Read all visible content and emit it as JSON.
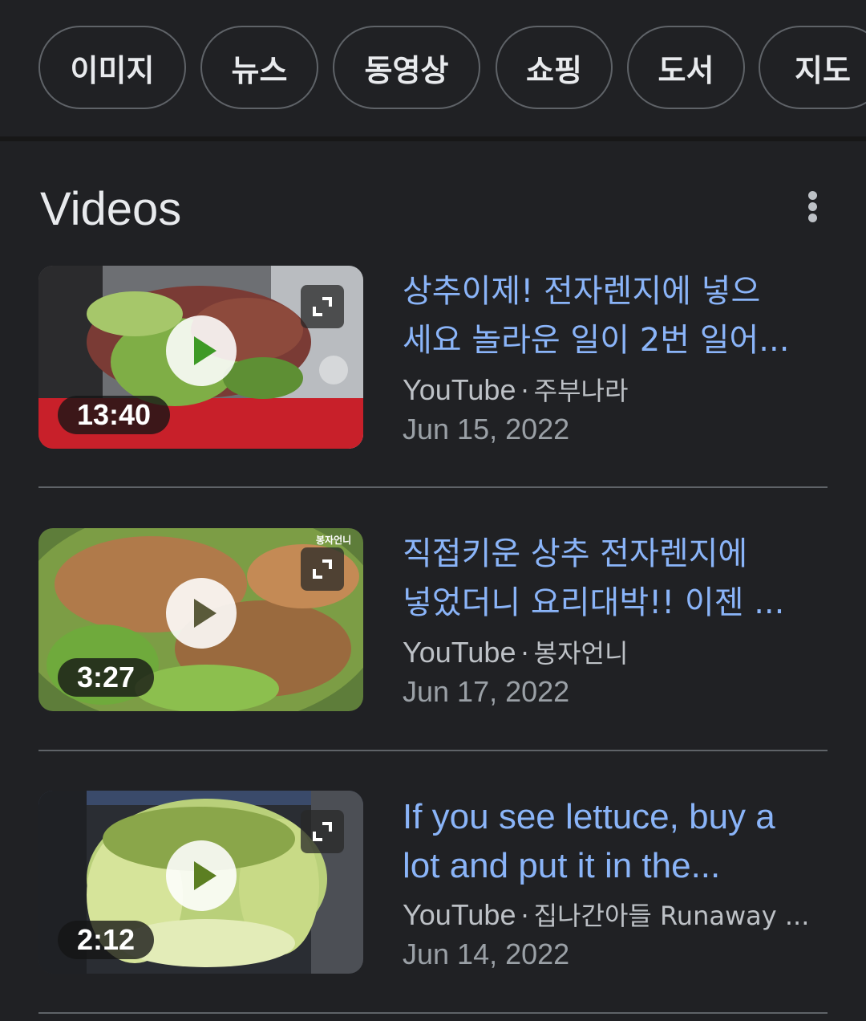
{
  "chips": [
    "이미지",
    "뉴스",
    "동영상",
    "쇼핑",
    "도서",
    "지도"
  ],
  "section": {
    "title": "Videos",
    "more_icon": "more-vert-icon"
  },
  "videos": [
    {
      "title_line1": "상추이제! 전자렌지에 넣으",
      "title_line2": "세요 놀라운 일이 2번 일어...",
      "source": "YouTube",
      "separator": "·",
      "channel": "주부나라",
      "date": "Jun 15, 2022",
      "duration": "13:40"
    },
    {
      "title_line1": "직접키운 상추 전자렌지에",
      "title_line2": "넣었더니 요리대박!! 이젠 ...",
      "source": "YouTube",
      "separator": "·",
      "channel": "봉자언니",
      "date": "Jun 17, 2022",
      "duration": "3:27",
      "watermark": "봉자언니"
    },
    {
      "title_line1": "If you see lettuce, buy a",
      "title_line2": "lot and put it in the...",
      "source": "YouTube",
      "separator": "·",
      "channel": "집나간아들 Runaway ...",
      "date": "Jun 14, 2022",
      "duration": "2:12"
    }
  ],
  "colors": {
    "background": "#202124",
    "title_link": "#8ab4f8",
    "chip_border": "#5f6368",
    "meta_text": "#bdc1c6"
  }
}
